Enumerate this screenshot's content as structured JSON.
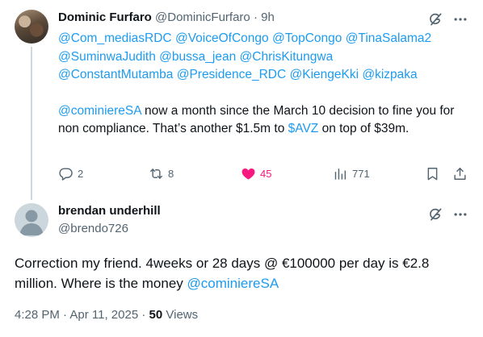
{
  "tweet": {
    "author_name": "Dominic Furfaro",
    "author_handle": "@DominicFurfaro",
    "dot": "·",
    "time": "9h",
    "mentions_line1": [
      "@Com_mediasRDC",
      "@VoiceOfCongo",
      "@TopCongo",
      "@TinaSalama2"
    ],
    "mentions_line2": [
      "@SuminwaJudith",
      "@bussa_jean",
      "@ChrisKitungwa"
    ],
    "mentions_line3": [
      "@ConstantMutamba",
      "@Presidence_RDC",
      "@KiengeKki",
      "@kizpaka"
    ],
    "body_mention": "@cominiereSA",
    "body_text_1": " now a month since the March 10 decision to fine you for non compliance. That’s another $1.5m to ",
    "body_cashtag": "$AVZ",
    "body_text_2": " on top of $39m.",
    "actions": {
      "reply_count": "2",
      "retweet_count": "8",
      "like_count": "45",
      "views_count": "771"
    },
    "colors": {
      "link": "#1d9bf0",
      "like": "#f91880",
      "muted": "#536471"
    }
  },
  "reply": {
    "author_name": "brendan underhill",
    "author_handle": "@brendo726",
    "body_text": "Correction my friend. 4weeks or 28 days @ €100000 per day is €2.8 million. Where is the money ",
    "body_mention": "@cominiereSA",
    "time": "4:28 PM",
    "dot1": "·",
    "date": "Apr 11, 2025",
    "dot2": "·",
    "views": "50",
    "views_label": "Views"
  }
}
